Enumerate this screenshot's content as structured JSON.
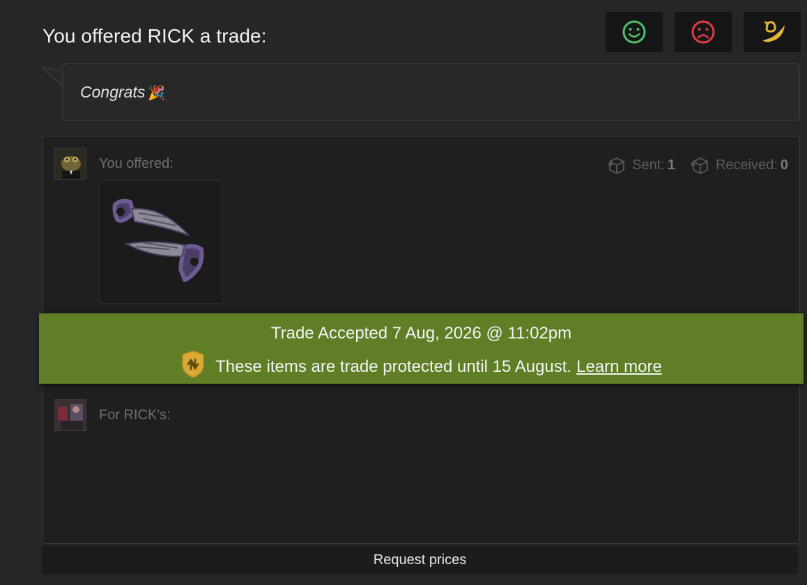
{
  "header": {
    "title": "You offered RICK a trade:"
  },
  "actions": [
    {
      "icon": "smiley-icon",
      "color": "#4fbf6e"
    },
    {
      "icon": "sad-face-icon",
      "color": "#e23b48"
    },
    {
      "icon": "ram-horn-icon",
      "color": "#e3b63b"
    }
  ],
  "message": {
    "text": "Congrats",
    "emoji": "🎉"
  },
  "offer": {
    "you_offered_label": "You offered:",
    "sent_label": "Sent:",
    "sent_count": "1",
    "received_label": "Received:",
    "received_count": "0",
    "for_label": "For RICK's:"
  },
  "banner": {
    "line1": "Trade Accepted 7 Aug, 2026 @ 11:02pm",
    "line2": "These items are trade protected until 15 August.",
    "link": "Learn more",
    "color": "#5f7e26"
  },
  "footer": {
    "request_prices_label": "Request prices"
  }
}
